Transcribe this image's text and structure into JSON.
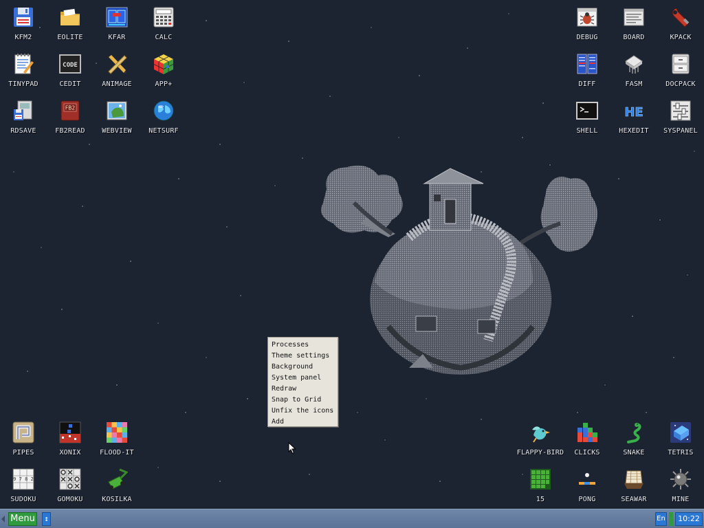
{
  "desktop": {
    "icons": {
      "kfm2": "KFM2",
      "eolite": "EOLITE",
      "kfar": "KFAR",
      "calc": "CALC",
      "tinypad": "TINYPAD",
      "cedit": "CEDIT",
      "animage": "ANIMAGE",
      "appplus": "APP+",
      "rdsave": "RDSAVE",
      "fb2read": "FB2READ",
      "webview": "WEBVIEW",
      "netsurf": "NETSURF",
      "debug": "DEBUG",
      "board": "BOARD",
      "kpack": "KPACK",
      "diff": "DIFF",
      "fasm": "FASM",
      "docpack": "DOCPACK",
      "shell": "SHELL",
      "hexedit": "HEXEDIT",
      "syspanel": "SYSPANEL",
      "pipes": "PIPES",
      "xonix": "XONIX",
      "floodit": "FLOOD-IT",
      "sudoku": "SUDOKU",
      "gomoku": "GOMOKU",
      "kosilka": "KOSILKA",
      "flappybird": "FLAPPY-BIRD",
      "clicks": "CLICKS",
      "snake": "SNAKE",
      "tetris": "TETRIS",
      "fifteen": "15",
      "pong": "PONG",
      "seawar": "SEAWAR",
      "mine": "MINE"
    },
    "icon_glyphs": {
      "cedit": "CODE",
      "fb2read": "FB2",
      "hexedit": "HE",
      "sudoku": "9 7 8 2"
    }
  },
  "context_menu": {
    "items": [
      "Processes",
      "Theme settings",
      "Background",
      "System panel",
      "Redraw",
      "Snap to Grid",
      "Unfix the icons",
      "Add"
    ]
  },
  "taskbar": {
    "menu_label": "Menu",
    "switch_glyph": "↕",
    "language": "En",
    "clock": "10:22"
  },
  "colors": {
    "desktop_bg": "#1c2431",
    "taskbar": "#5a7396",
    "menu_button": "#2f9a3e",
    "taskbar_badge": "#2b77d4",
    "context_menu_bg": "#e7e4dc"
  }
}
